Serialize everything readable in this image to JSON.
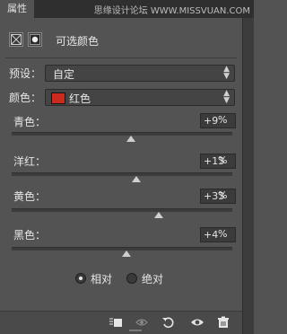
{
  "panel_tab": "属性",
  "watermark": "思缘设计论坛 WWW.MISSVUAN.COM",
  "header": {
    "label": "可选颜色",
    "icons": [
      "adjustment-icon",
      "mask-icon"
    ]
  },
  "preset": {
    "label": "预设：",
    "value": "自定"
  },
  "colors": {
    "label": "颜色：",
    "value": "红色",
    "swatch": "#cc2a1e"
  },
  "sliders": [
    {
      "label": "青色：",
      "value": "+9",
      "unit": "%",
      "level": 0.54
    },
    {
      "label": "洋红：",
      "value": "+13",
      "unit": "%",
      "level": 0.565
    },
    {
      "label": "黄色：",
      "value": "+33",
      "unit": "%",
      "level": 0.665
    },
    {
      "label": "黑色：",
      "value": "+4",
      "unit": "%",
      "level": 0.52
    }
  ],
  "method": {
    "options": [
      "相对",
      "绝对"
    ],
    "selected": "相对"
  },
  "footer": {
    "icons": [
      "clip-to-layer-icon",
      "view-previous-state-icon",
      "reset-icon",
      "visibility-eye-icon",
      "trash-icon"
    ]
  }
}
